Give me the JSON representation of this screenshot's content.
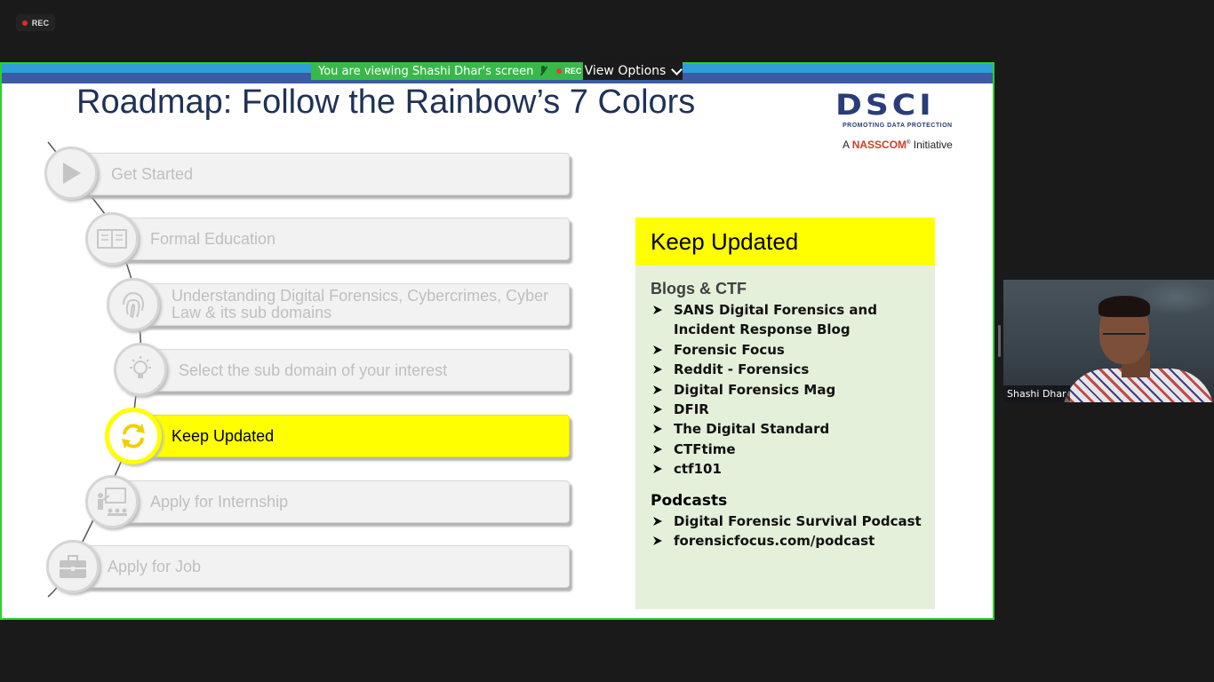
{
  "rec_badge": {
    "label": "REC"
  },
  "banner": {
    "viewing_text": "You are viewing Shashi Dhar's screen",
    "rec_label": "REC",
    "view_options_label": "View Options"
  },
  "slide": {
    "title": "Roadmap: Follow the Rainbow’s 7 Colors",
    "logo": {
      "main": "DSCI",
      "tagline": "PROMOTING DATA PROTECTION",
      "initiative_prefix": "A",
      "initiative_brand": "NASSCOM",
      "initiative_suffix": "Initiative"
    },
    "steps": [
      {
        "label": "Get Started",
        "icon": "play-icon",
        "active": false
      },
      {
        "label": "Formal Education",
        "icon": "book-icon",
        "active": false
      },
      {
        "label": "Understanding Digital Forensics, Cybercrimes, Cyber Law & its sub domains",
        "icon": "fingerprint-icon",
        "active": false
      },
      {
        "label": "Select the sub domain of your interest",
        "icon": "lightbulb-icon",
        "active": false
      },
      {
        "label": "Keep Updated",
        "icon": "refresh-icon",
        "active": true
      },
      {
        "label": "Apply for Internship",
        "icon": "presentation-icon",
        "active": false
      },
      {
        "label": "Apply for Job",
        "icon": "briefcase-icon",
        "active": false
      }
    ],
    "panel": {
      "heading": "Keep Updated",
      "blogs_title": "Blogs & CTF",
      "blogs": [
        "SANS Digital Forensics and Incident Response Blog",
        "Forensic Focus",
        "Reddit - Forensics",
        "Digital Forensics Mag",
        "DFIR",
        "The Digital Standard",
        "CTFtime",
        "ctf101"
      ],
      "podcasts_title": "Podcasts",
      "podcasts": [
        "Digital Forensic Survival Podcast",
        "forensicfocus.com/podcast"
      ]
    }
  },
  "participant": {
    "name": "Shashi Dhar"
  },
  "colors": {
    "accent_yellow": "#ffff00",
    "panel_green": "#e5f0da",
    "share_border": "#2bd12b",
    "title_navy": "#1f3256"
  }
}
